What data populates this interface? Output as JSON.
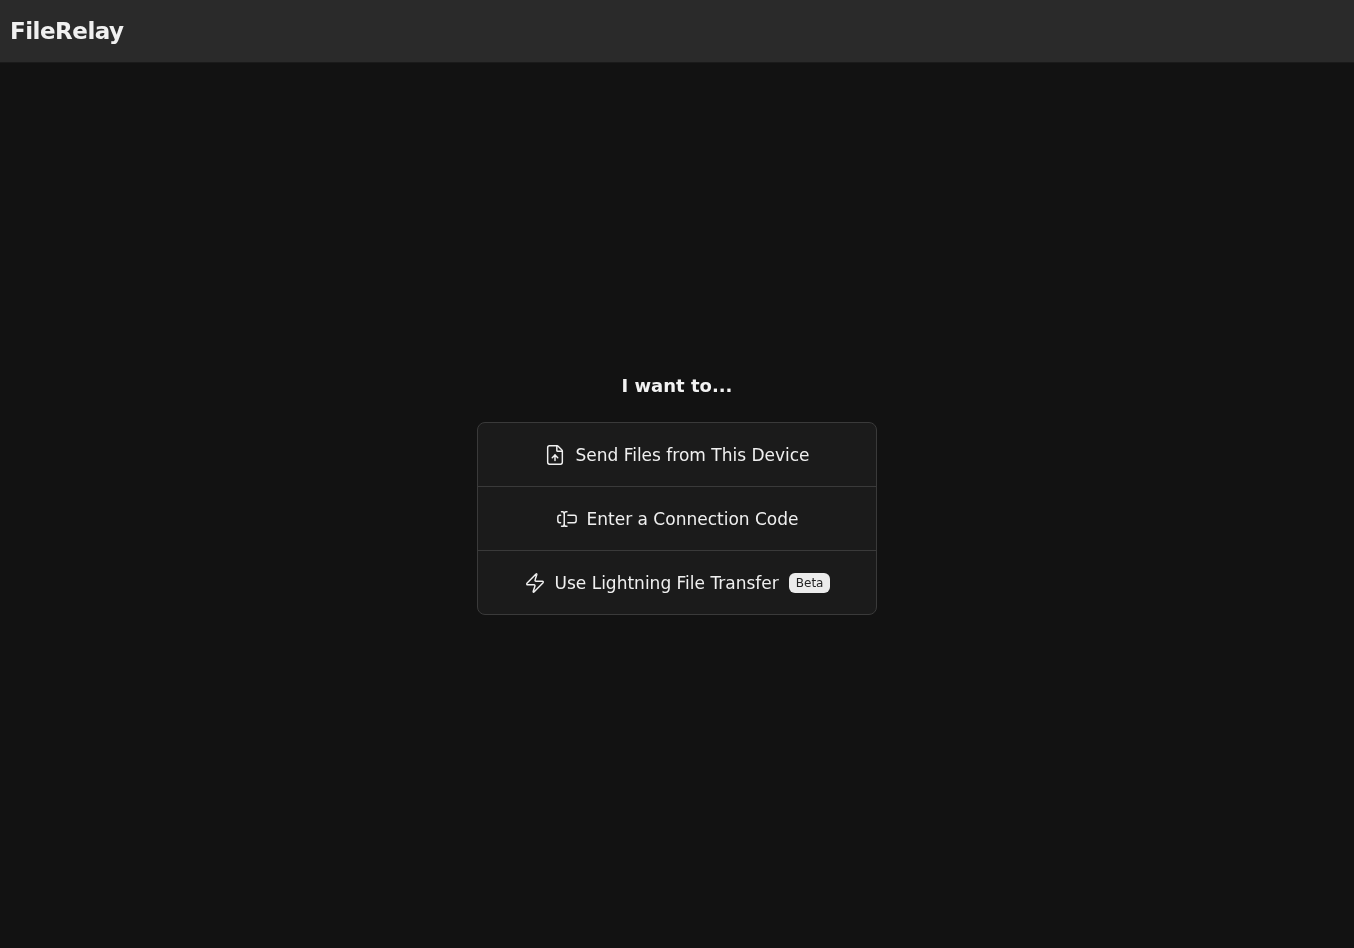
{
  "header": {
    "title": "FileRelay"
  },
  "prompt": "I want to...",
  "options": [
    {
      "kind": "send",
      "label": "Send Files from This Device"
    },
    {
      "kind": "code",
      "label": "Enter a Connection Code"
    },
    {
      "kind": "lightning",
      "label": "Use Lightning File Transfer",
      "badge": "Beta"
    }
  ]
}
